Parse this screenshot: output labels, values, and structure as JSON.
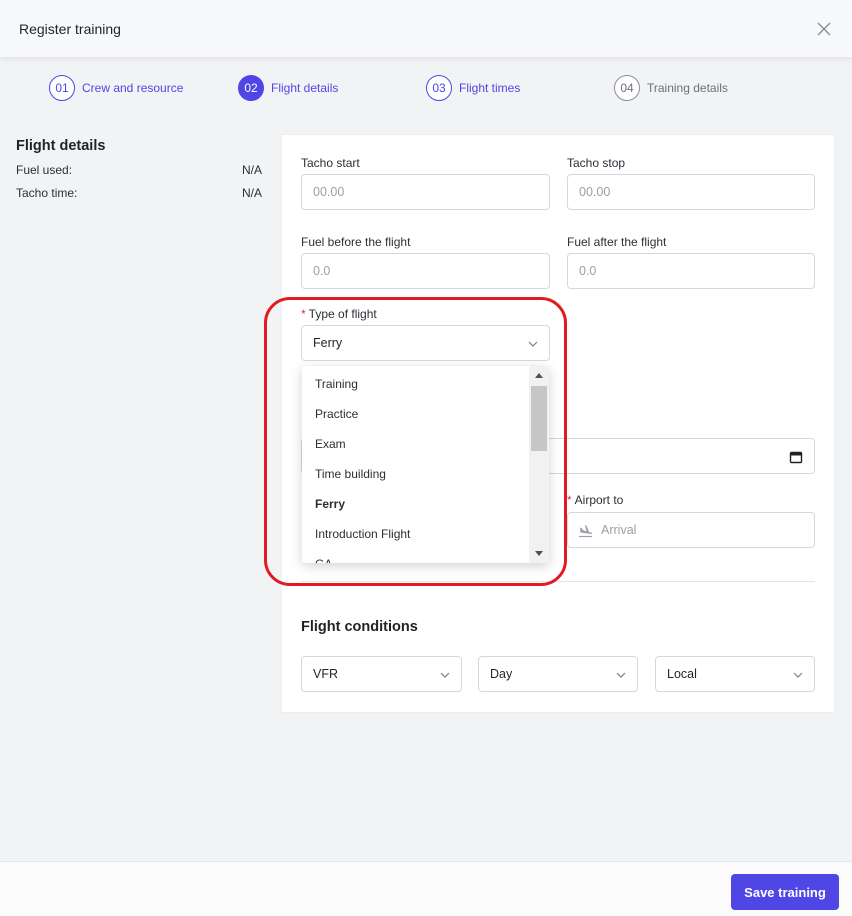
{
  "header": {
    "title": "Register training"
  },
  "steps": [
    {
      "number": "01",
      "label": "Crew and resource",
      "state": "done"
    },
    {
      "number": "02",
      "label": "Flight details",
      "state": "active"
    },
    {
      "number": "03",
      "label": "Flight times",
      "state": "done"
    },
    {
      "number": "04",
      "label": "Training details",
      "state": "inactive"
    }
  ],
  "summary": {
    "title": "Flight details",
    "fuel_used_label": "Fuel used:",
    "fuel_used_value": "N/A",
    "tacho_time_label": "Tacho time:",
    "tacho_time_value": "N/A"
  },
  "form": {
    "tacho_start": {
      "label": "Tacho start",
      "placeholder": "00.00"
    },
    "tacho_stop": {
      "label": "Tacho stop",
      "placeholder": "00.00"
    },
    "fuel_before": {
      "label": "Fuel before the flight",
      "placeholder": "0.0"
    },
    "fuel_after": {
      "label": "Fuel after the flight",
      "placeholder": "0.0"
    },
    "type_of_flight": {
      "label": "Type of flight",
      "required_mark": "*",
      "value": "Ferry",
      "options": [
        "Training",
        "Practice",
        "Exam",
        "Time building",
        "Ferry",
        "Introduction Flight",
        "GA"
      ]
    },
    "airport_to": {
      "label": "Airport to",
      "required_mark": "*",
      "placeholder": "Arrival"
    }
  },
  "conditions": {
    "title": "Flight conditions",
    "rules": "VFR",
    "light": "Day",
    "scope": "Local"
  },
  "footer": {
    "save_label": "Save training"
  },
  "colors": {
    "accent": "#4f46e5",
    "highlight": "#e01b24"
  }
}
